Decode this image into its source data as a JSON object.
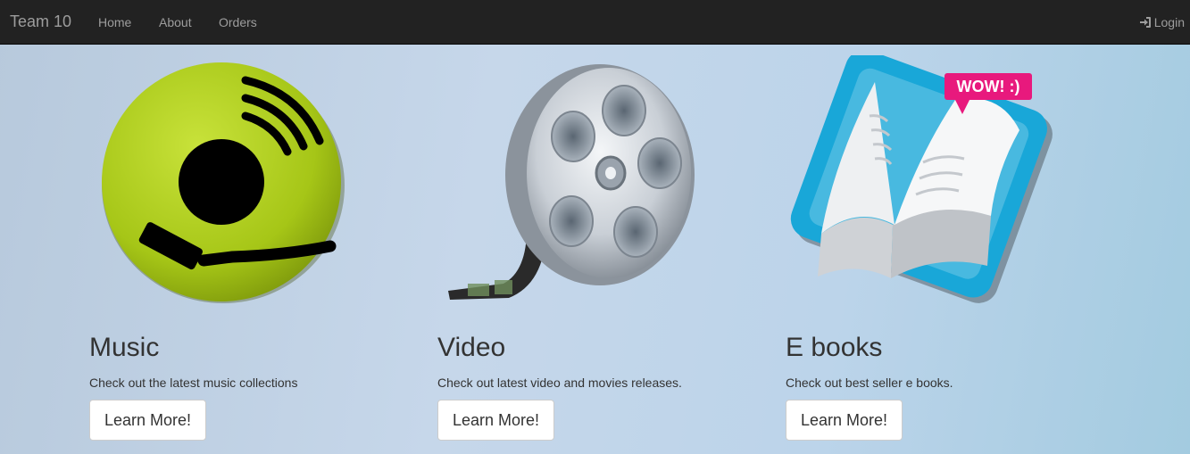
{
  "navbar": {
    "brand": "Team 10",
    "links": [
      "Home",
      "About",
      "Orders"
    ],
    "login": "Login"
  },
  "cards": [
    {
      "title": "Music",
      "text": "Check out the latest music collections",
      "button": "Learn More!",
      "icon": "music-disc-icon"
    },
    {
      "title": "Video",
      "text": "Check out latest video and movies releases.",
      "button": "Learn More!",
      "icon": "film-reel-icon"
    },
    {
      "title": "E books",
      "text": "Check out best seller e books.",
      "button": "Learn More!",
      "icon": "open-book-icon",
      "badge": "WOW! :)"
    }
  ],
  "colors": {
    "navbar": "#222222",
    "nav_text": "#9d9d9d",
    "disc": "#a8c81a",
    "book_frame": "#1aa5d6",
    "badge": "#e8197d"
  }
}
